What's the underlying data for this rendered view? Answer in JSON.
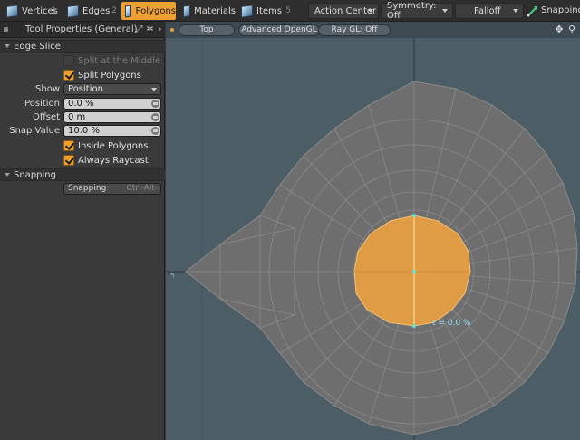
{
  "toolbar": {
    "modes": [
      {
        "label": "Vertices",
        "shortcut": "1",
        "active": false
      },
      {
        "label": "Edges",
        "shortcut": "2",
        "active": false
      },
      {
        "label": "Polygons",
        "shortcut": "",
        "active": true
      },
      {
        "label": "Materials",
        "shortcut": "",
        "active": false
      },
      {
        "label": "Items",
        "shortcut": "5",
        "active": false
      }
    ],
    "action_center": "Action Center",
    "symmetry": "Symmetry: Off",
    "falloff": "Falloff",
    "snapping": "Snapping"
  },
  "panel": {
    "title": "Tool Properties (General)",
    "edge_slice": {
      "label": "Edge Slice",
      "split_at_middle": {
        "label": "Split at the Middle",
        "checked": false
      },
      "split_polygons": {
        "label": "Split Polygons",
        "checked": true
      },
      "show_label": "Show",
      "show_value": "Position",
      "position_label": "Position",
      "position_value": "0.0 %",
      "offset_label": "Offset",
      "offset_value": "0 m",
      "snap_value_label": "Snap Value",
      "snap_value": "10.0 %",
      "inside_polygons": {
        "label": "Inside Polygons",
        "checked": true
      },
      "always_raycast": {
        "label": "Always Raycast",
        "checked": true
      }
    },
    "snapping": {
      "label": "Snapping",
      "button_label": "Snapping",
      "button_shortcut": "Ctrl-Alt-"
    }
  },
  "viewport": {
    "view": "Top",
    "renderer": "Advanced OpenGL",
    "raygl": "Ray GL: Off",
    "overlay_label": "t = 0.0 %"
  },
  "colors": {
    "accent": "#f0a030",
    "viewport_bg": "#4d5d66",
    "mesh": "#7a7a7a",
    "selection": "#e8a040"
  }
}
